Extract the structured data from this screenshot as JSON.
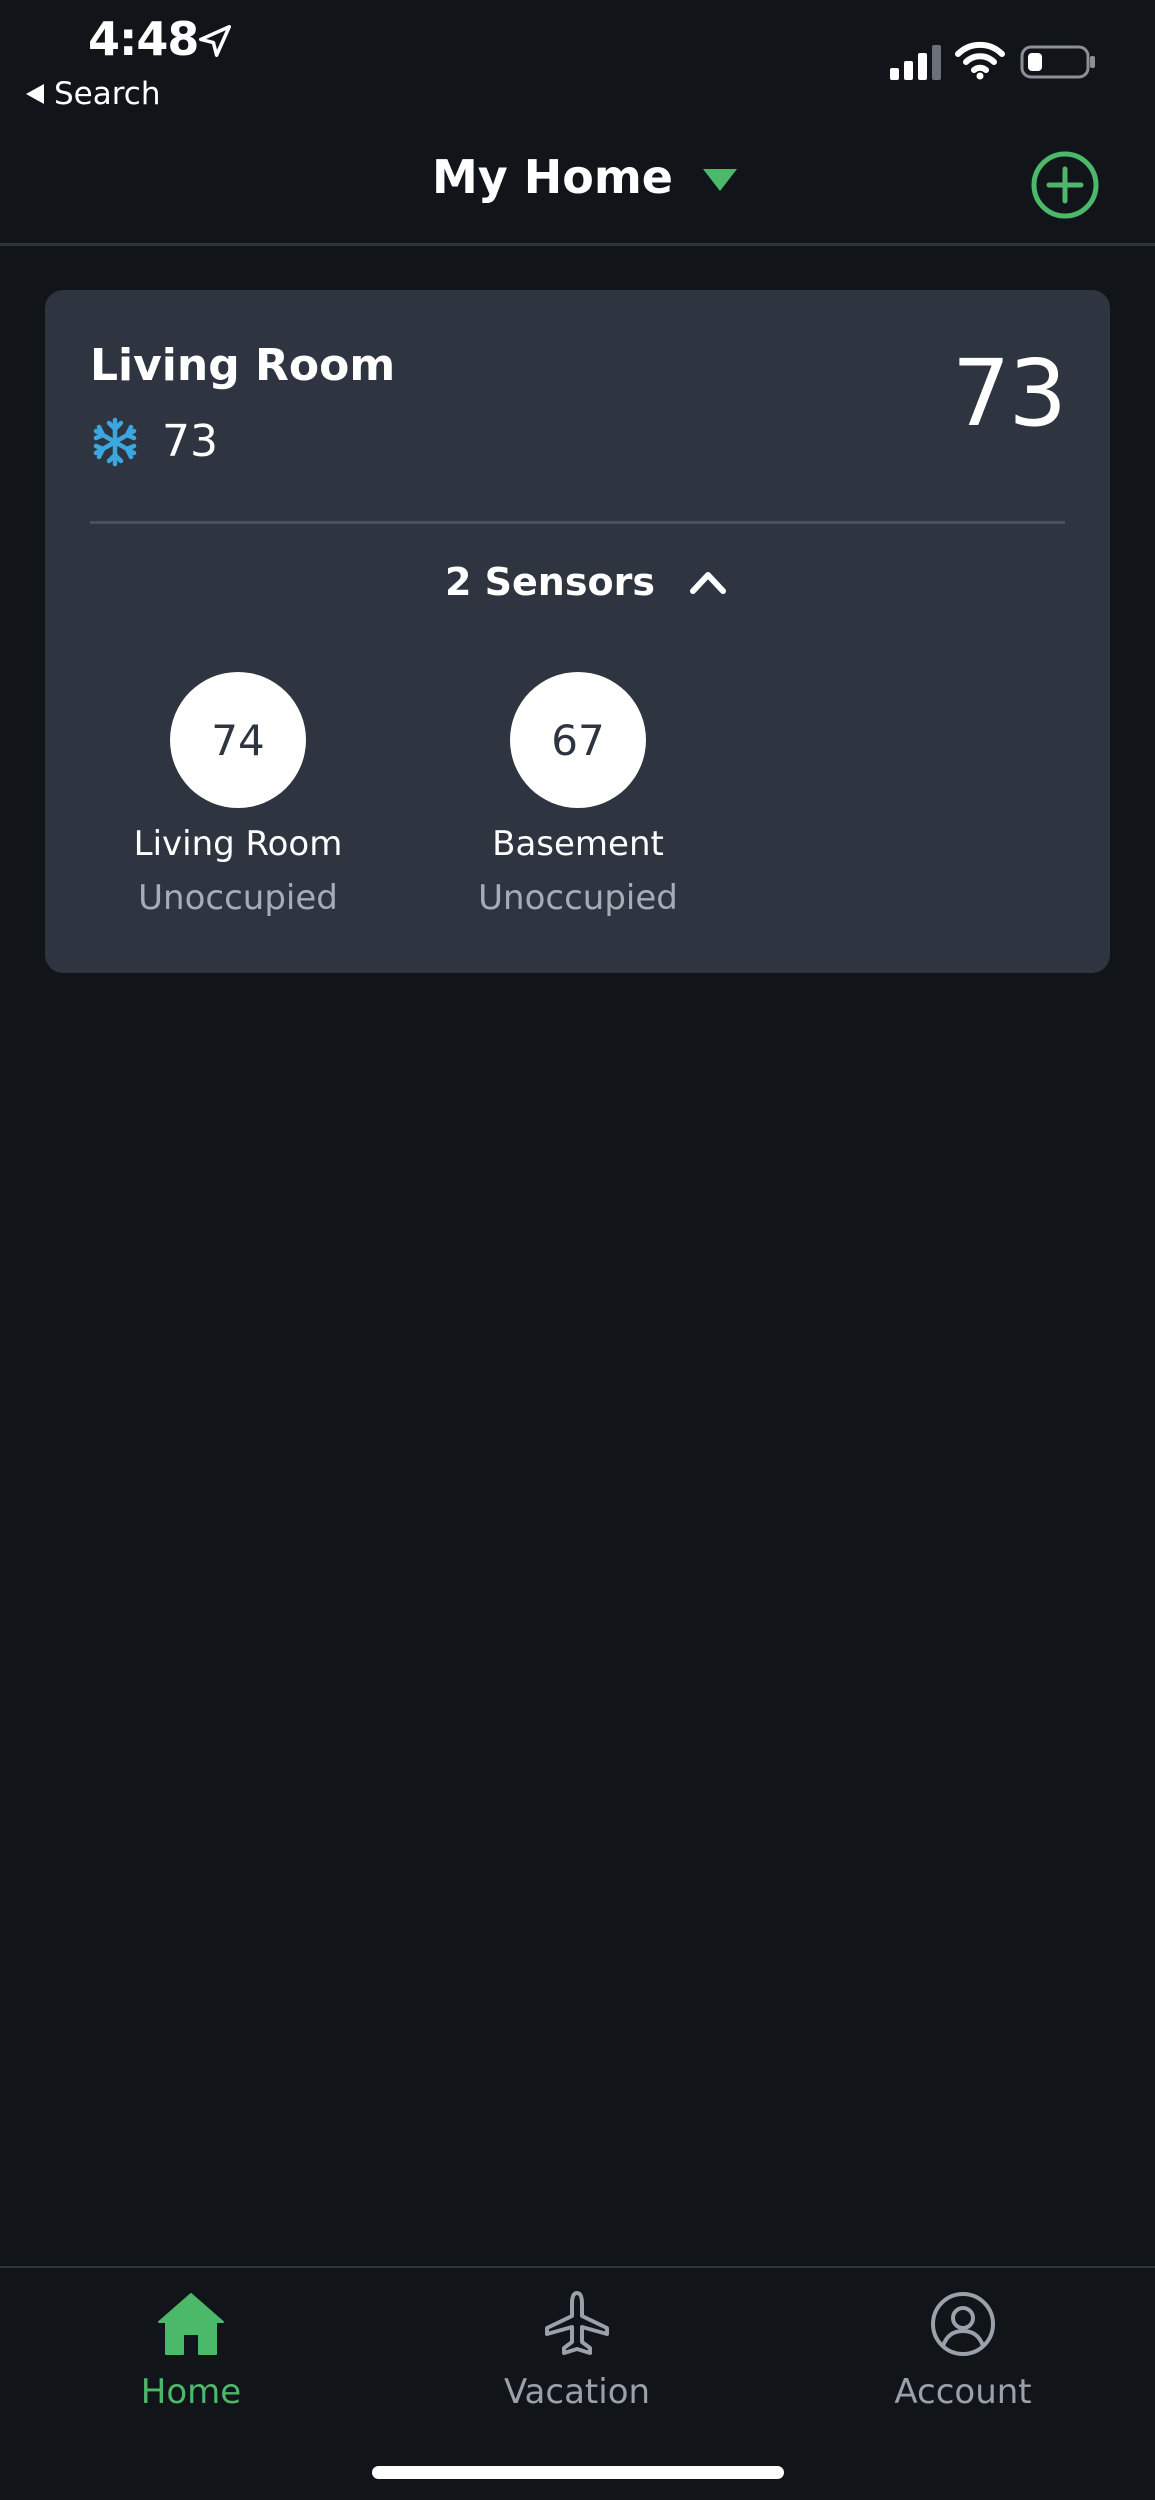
{
  "status_bar": {
    "time": "4:48",
    "back_label": "Search"
  },
  "header": {
    "title": "My Home",
    "accent_color": "#4cb86a"
  },
  "thermostat": {
    "room_name": "Living Room",
    "mode_icon": "snowflake-icon",
    "setpoint": "73",
    "current_temp": "73",
    "sensors_toggle_label": "2 Sensors",
    "sensors": [
      {
        "temp": "74",
        "name": "Living Room",
        "status": "Unoccupied"
      },
      {
        "temp": "67",
        "name": "Basement",
        "status": "Unoccupied"
      }
    ]
  },
  "tab_bar": {
    "tabs": [
      {
        "label": "Home",
        "icon": "home-icon",
        "active": true
      },
      {
        "label": "Vacation",
        "icon": "airplane-icon",
        "active": false
      },
      {
        "label": "Account",
        "icon": "account-icon",
        "active": false
      }
    ],
    "active_color": "#4cb86a",
    "inactive_color": "#9aa1ab"
  }
}
